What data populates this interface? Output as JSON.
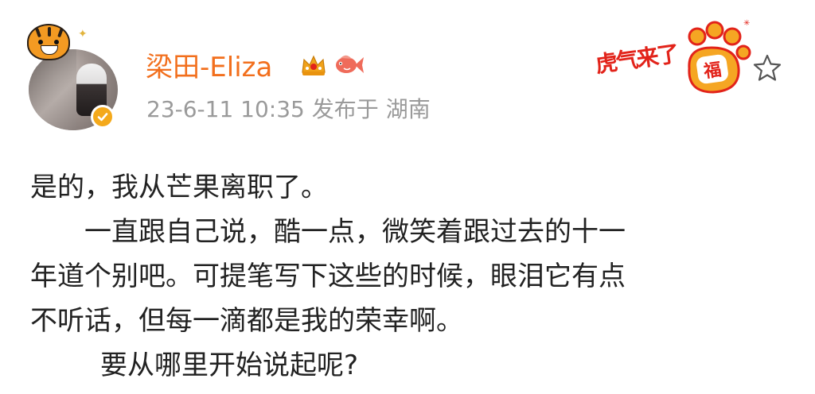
{
  "post": {
    "author": {
      "name": "梁田-Eliza",
      "avatar_icon": "avatar-photo",
      "verified_icon": "verified-check-icon",
      "badges": [
        "crown-badge-icon",
        "koi-fish-badge-icon"
      ]
    },
    "meta": {
      "timestamp": "23-6-11 10:35",
      "location_prefix": "发布于",
      "location": "湖南"
    },
    "decoration": {
      "banner_text": "虎气来了",
      "paw_text": "福"
    },
    "actions": {
      "favorite_icon": "star-icon"
    },
    "body": [
      "是的，我从芒果离职了。",
      "一直跟自己说，酷一点，微笑着跟过去的十一",
      "年道个别吧。可提笔写下这些的时候，眼泪它有点",
      "不听话，但每一滴都是我的荣幸啊。",
      "要从哪里开始说起呢?"
    ]
  },
  "colors": {
    "username": "#f26f1d",
    "meta_text": "#9a9a9a",
    "body_text": "#222222",
    "verified_badge": "#f4a91b",
    "festive_red": "#e2231a",
    "paw_orange": "#f5a623"
  }
}
